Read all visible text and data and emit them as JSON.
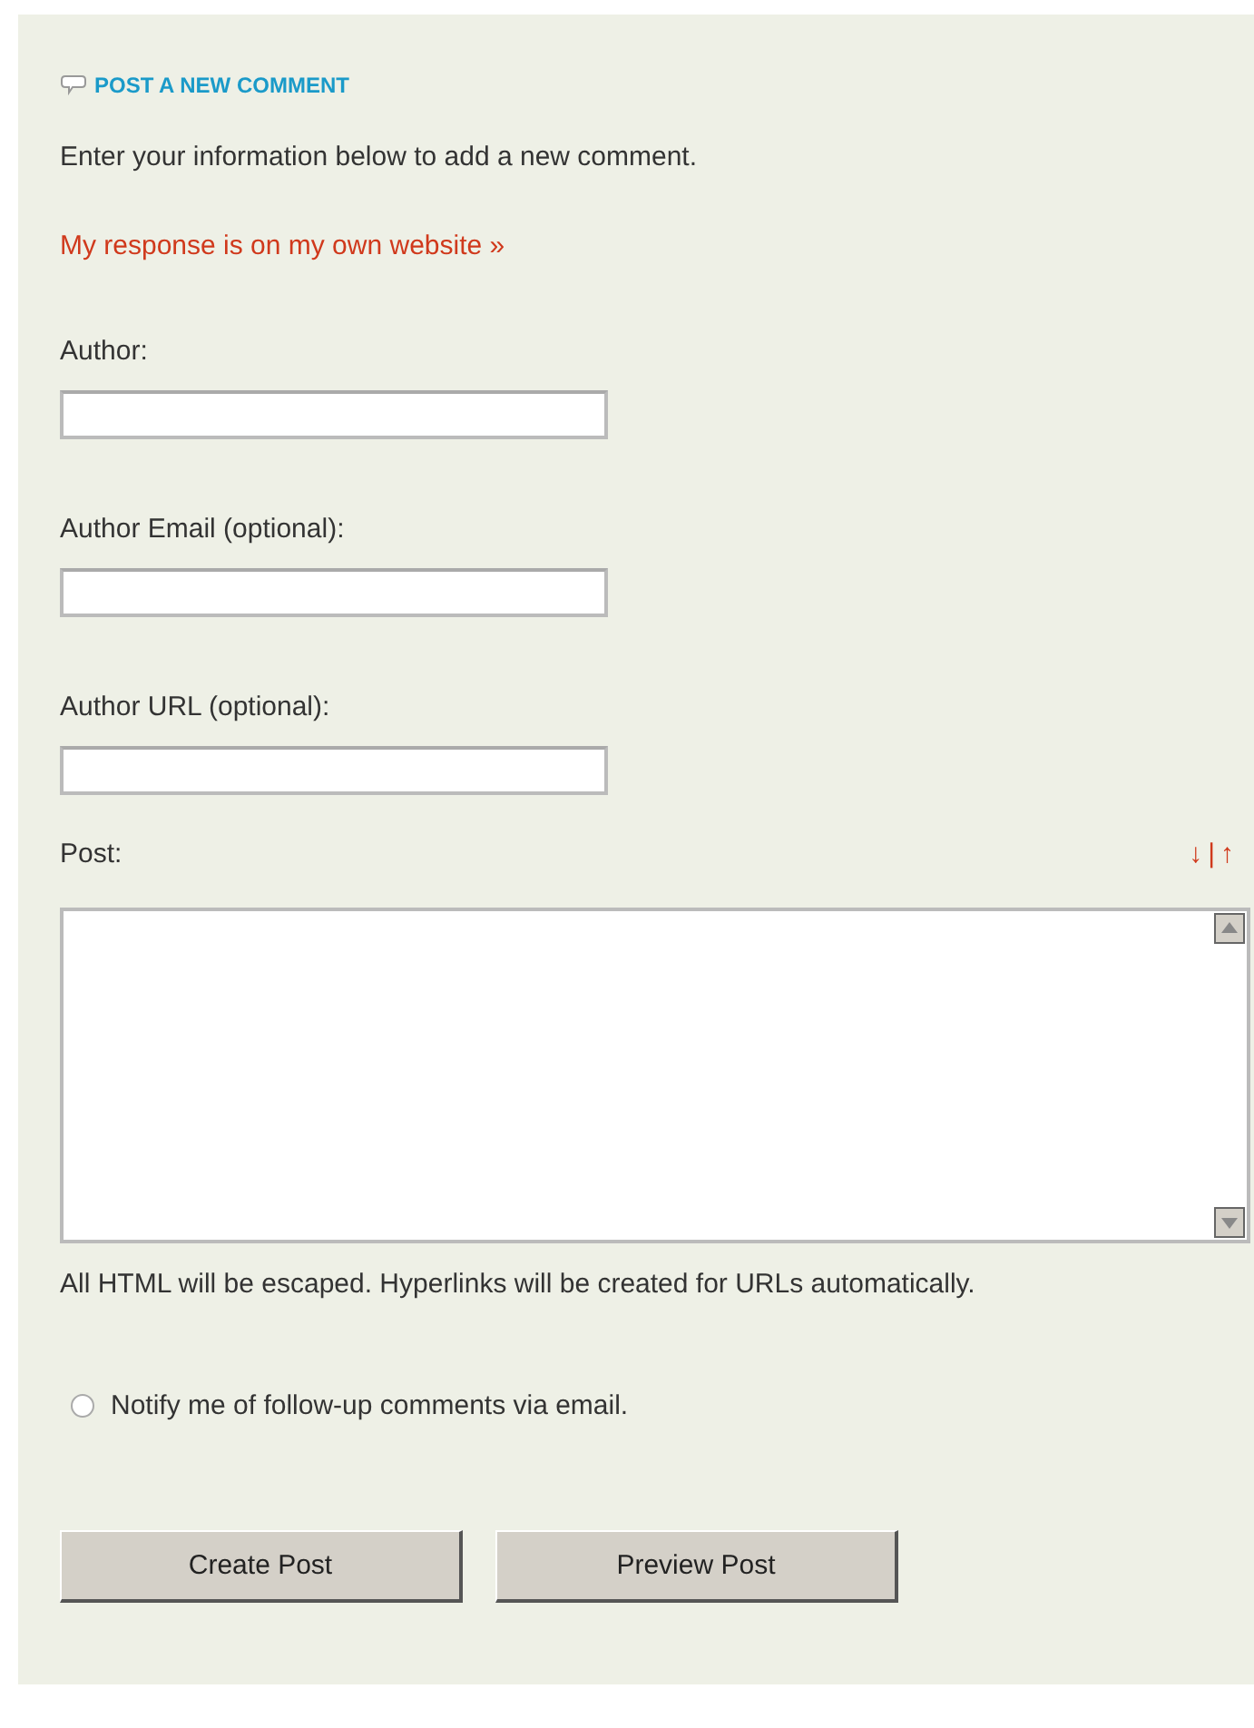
{
  "heading": "POST A NEW COMMENT",
  "intro": "Enter your information below to add a new comment.",
  "website_link": "My response is on my own website »",
  "fields": [
    {
      "label": "Author:"
    },
    {
      "label": "Author Email (optional):"
    },
    {
      "label": "Author URL (optional):"
    }
  ],
  "post": {
    "label": "Post:",
    "resize_down": "↓",
    "separator": "|",
    "resize_up": "↑"
  },
  "note": "All HTML will be escaped. Hyperlinks will be created for URLs automatically.",
  "notify": {
    "label": "Notify me of follow-up comments via email.",
    "checked": false
  },
  "buttons": [
    "Create Post",
    "Preview Post"
  ]
}
